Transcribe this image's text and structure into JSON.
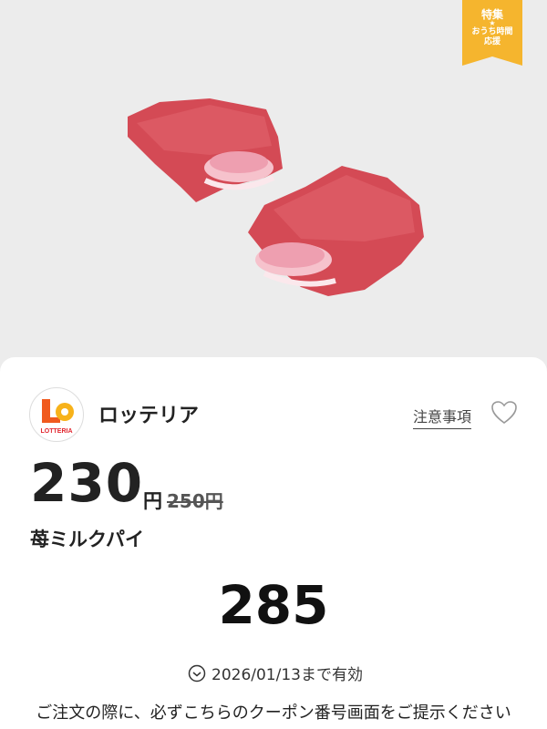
{
  "hero": {
    "image_label": "strawberry-milk-pie-photo",
    "badge": {
      "title": "特集",
      "star": "★",
      "subtitle_line1": "おうち時間",
      "subtitle_line2": "応援",
      "color": "#f5b52e"
    }
  },
  "store": {
    "name": "ロッテリア",
    "logo_text": "LOTTERIA",
    "logo_icon": "lotteria-logo"
  },
  "actions": {
    "notice_label": "注意事項",
    "favorite_icon": "heart-icon"
  },
  "price": {
    "current": "230",
    "unit": "円",
    "original": "250円"
  },
  "product": {
    "name": "苺ミルクパイ"
  },
  "coupon": {
    "number": "285",
    "validity": "2026/01/13まで有効",
    "instruction": "ご注文の際に、必ずこちらのクーポン番号画面をご提示ください"
  }
}
